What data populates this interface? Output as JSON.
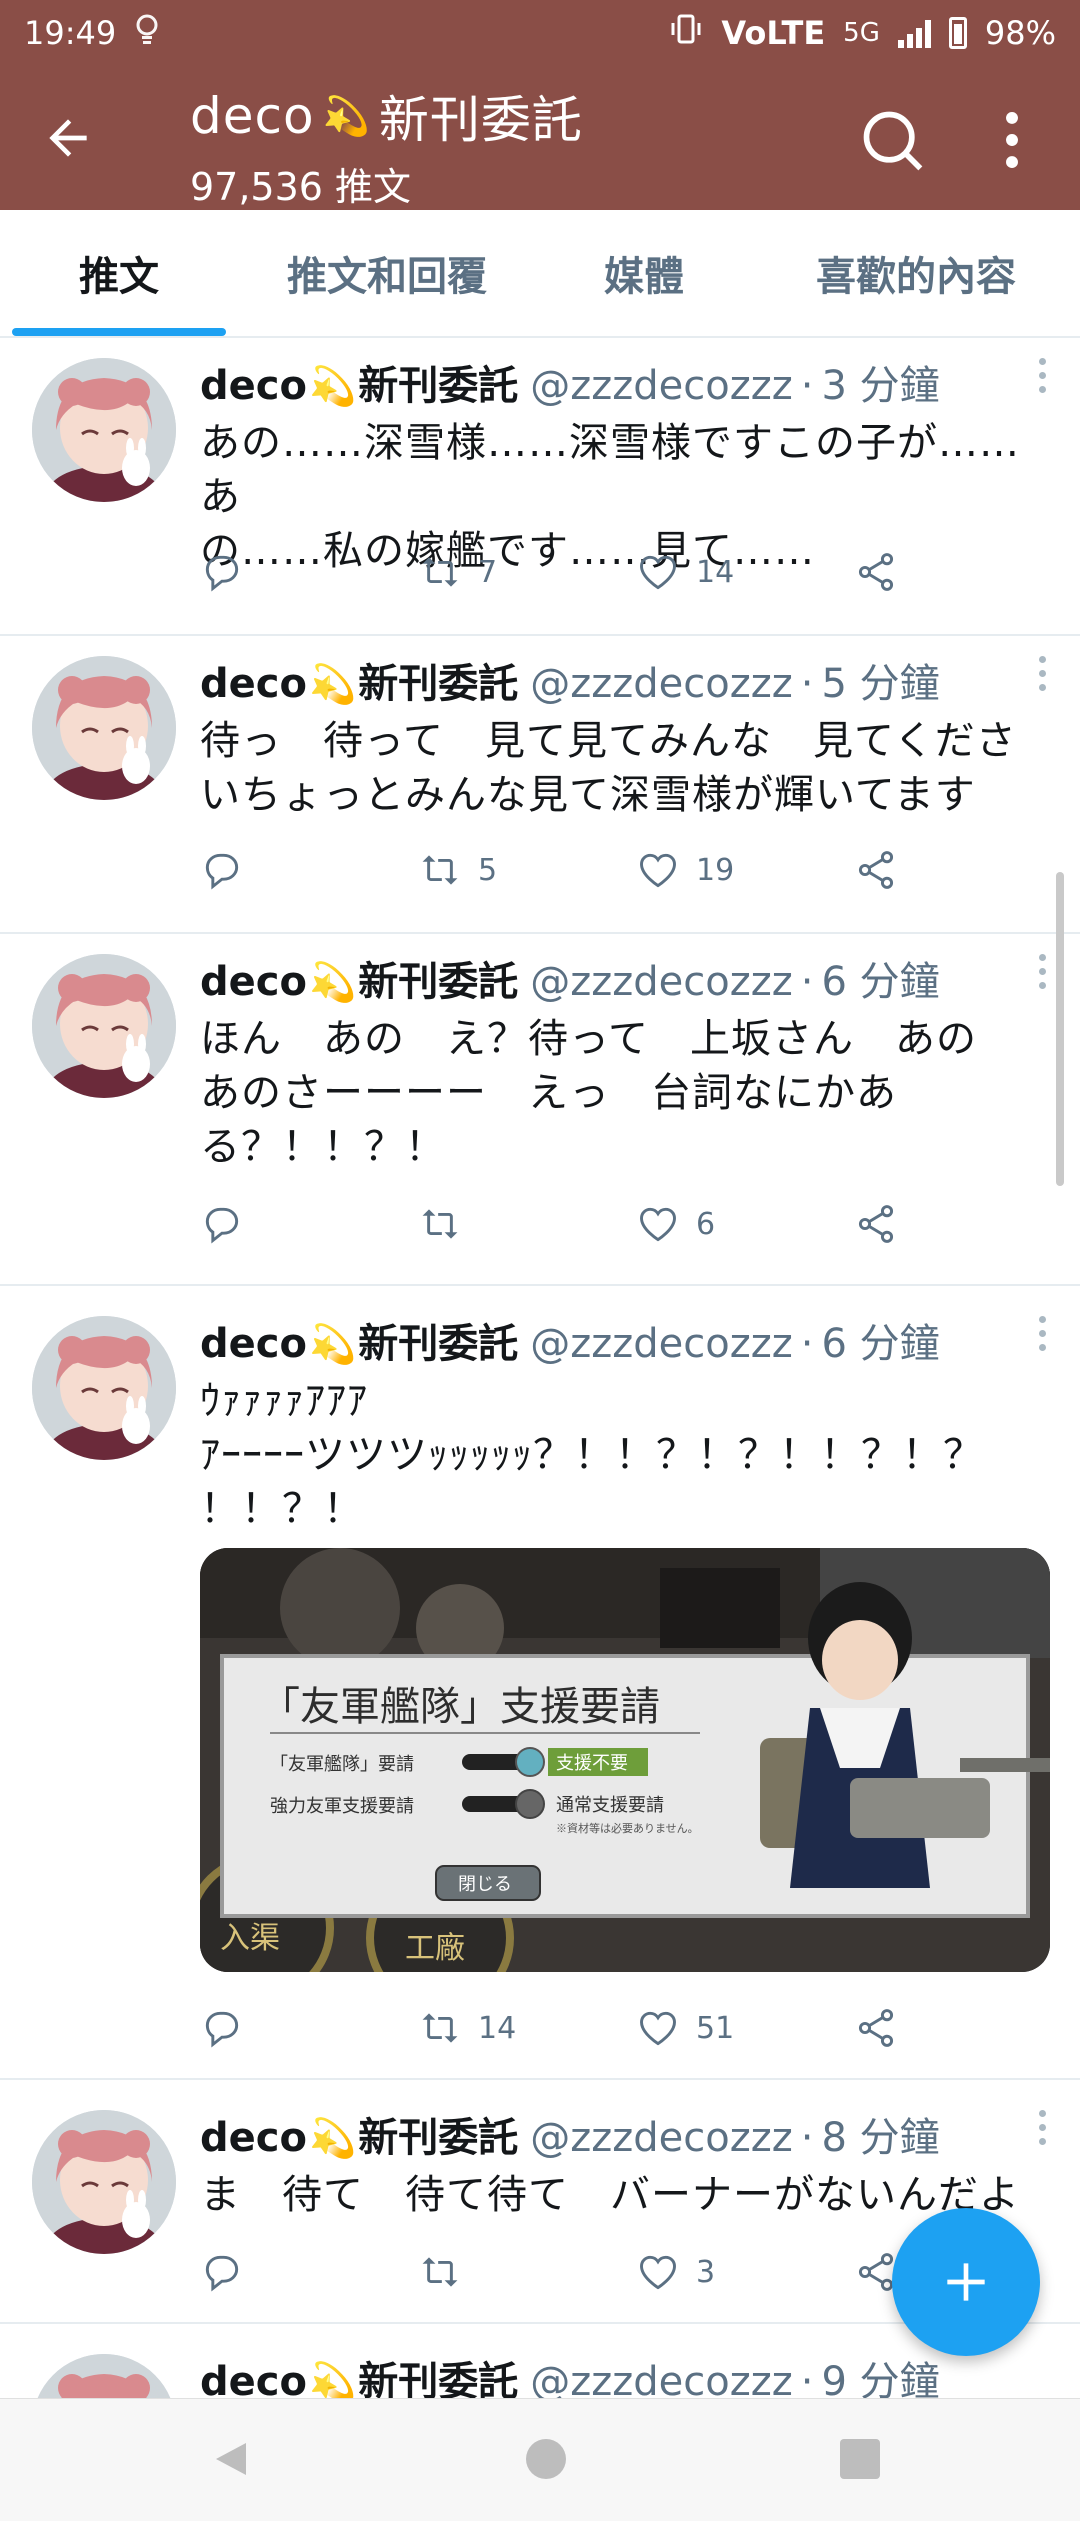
{
  "status_bar": {
    "time": "19:49",
    "network": "5G",
    "volte": "VoLTE",
    "battery": "98%",
    "icons": [
      "bulb-icon",
      "vibrate-icon",
      "volte-icon",
      "signal-icon",
      "battery-icon"
    ]
  },
  "header": {
    "name_prefix": "deco",
    "name_emoji": "💫",
    "name_suffix": "新刊委託",
    "tweet_count": "97,536 推文",
    "icons": [
      "back-arrow-icon",
      "search-icon",
      "more-vertical-icon"
    ]
  },
  "tabs": [
    {
      "label": "推文",
      "active": true
    },
    {
      "label": "推文和回覆",
      "active": false
    },
    {
      "label": "媒體",
      "active": false
    },
    {
      "label": "喜歡的內容",
      "active": false
    }
  ],
  "tweets": [
    {
      "name_prefix": "deco",
      "name_emoji": "💫",
      "name_suffix": "新刊委託",
      "handle": "@zzzdecozzz",
      "dot": "·",
      "time": "3 分鐘",
      "lines": [
        "あの……深雪様……深雪様ですこの子が……あ",
        "の……私の嫁艦です……見て……"
      ],
      "retweets": "7",
      "likes": "14"
    },
    {
      "name_prefix": "deco",
      "name_emoji": "💫",
      "name_suffix": "新刊委託",
      "handle": "@zzzdecozzz",
      "dot": "·",
      "time": "5 分鐘",
      "lines": [
        "待っ　待って　見て見てみんな　見てくださ",
        "いちょっとみんな見て深雪様が輝いてます"
      ],
      "retweets": "5",
      "likes": "19"
    },
    {
      "name_prefix": "deco",
      "name_emoji": "💫",
      "name_suffix": "新刊委託",
      "handle": "@zzzdecozzz",
      "dot": "·",
      "time": "6 分鐘",
      "lines": [
        "ほん　あの　え？待って　上坂さん　あの",
        "あのさーーーー　えっ　台詞なにかあ",
        "る？！！？！"
      ],
      "retweets": "",
      "likes": "6"
    },
    {
      "name_prefix": "deco",
      "name_emoji": "💫",
      "name_suffix": "新刊委託",
      "handle": "@zzzdecozzz",
      "dot": "·",
      "time": "6 分鐘",
      "lines": [
        "ｳｧｧｧｧｱｱｱ",
        "ｱｰｰｰｰツツツｯｯｯｯｯ？！！？！？！！？！？",
        "！！？！"
      ],
      "retweets": "14",
      "likes": "51",
      "media": {
        "dialog_title": "「友軍艦隊」支援要請",
        "row1_label": "「友軍艦隊」要請",
        "row1_value": "支援不要",
        "row2_label": "強力友軍支援要請",
        "row2_value": "通常支援要請",
        "row2_note": "※資材等は必要ありません。",
        "close_button": "閉じる",
        "bg_text_1": "入渠",
        "bg_text_2": "工廠"
      }
    },
    {
      "name_prefix": "deco",
      "name_emoji": "💫",
      "name_suffix": "新刊委託",
      "handle": "@zzzdecozzz",
      "dot": "·",
      "time": "8 分鐘",
      "lines": [
        "ま　待て　待て待て　バーナーがないんだよ"
      ],
      "retweets": "",
      "likes": "3"
    },
    {
      "name_prefix": "deco",
      "name_emoji": "💫",
      "name_suffix": "新刊委託",
      "handle": "@zzzdecozzz",
      "dot": "·",
      "time": "9 分鐘",
      "lines": []
    }
  ],
  "fab": {
    "icon": "plus-icon"
  },
  "colors": {
    "header": "#8a4e47",
    "accent": "#1da1f2",
    "muted": "#5b7083",
    "divider": "#e6ecf0"
  }
}
